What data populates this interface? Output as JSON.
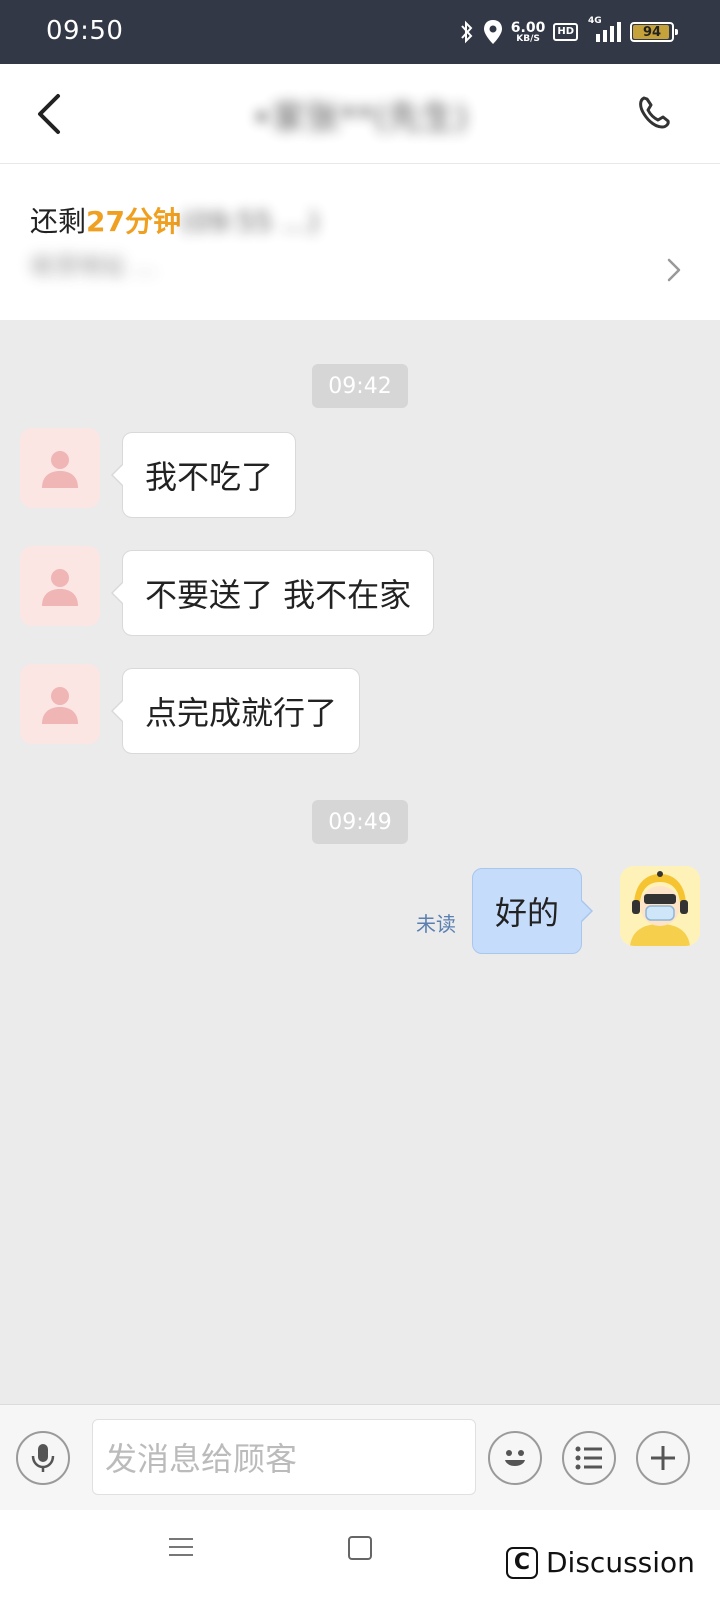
{
  "status_bar": {
    "time": "09:50",
    "speed_value": "6.00",
    "speed_unit": "KB/S",
    "hd_label": "HD",
    "network": "4G",
    "battery": "94"
  },
  "header": {
    "title": "•家张**(先生)"
  },
  "info": {
    "prefix": "还剩",
    "minutes": "27分钟",
    "suffix": "(09:55 ...)",
    "address": "收货地址 ..."
  },
  "messages": {
    "ts1": "09:42",
    "m1": "我不吃了",
    "m2": "不要送了   我不在家",
    "m3": "点完成就行了",
    "ts2": "09:49",
    "reply": "好的",
    "unread": "未读"
  },
  "input": {
    "placeholder": "发消息给顾客"
  },
  "watermark": {
    "letter": "C",
    "text": "Discussion"
  },
  "colors": {
    "status_bar": "#323845",
    "highlight": "#f0a020",
    "outgoing_bubble": "#c6dcfb",
    "chat_background": "#ebebeb"
  }
}
